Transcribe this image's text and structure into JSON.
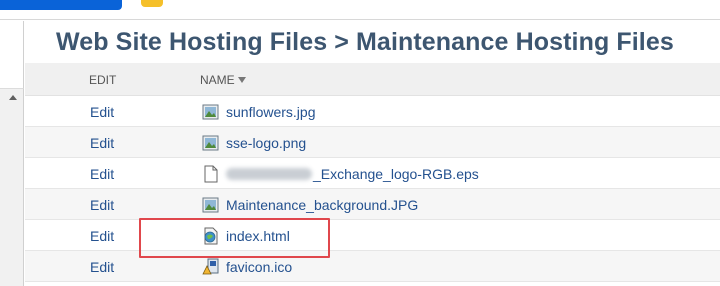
{
  "title": "Web Site Hosting Files > Maintenance Hosting Files",
  "colors": {
    "title": "#3d5670",
    "link": "#24518f",
    "highlight": "#e0474c"
  },
  "table": {
    "columns": {
      "edit": "EDIT",
      "name": "NAME"
    },
    "rows": [
      {
        "edit": "Edit",
        "name": "sunflowers.jpg",
        "icon": "image-file-icon"
      },
      {
        "edit": "Edit",
        "name": "sse-logo.png",
        "icon": "image-file-icon"
      },
      {
        "edit": "Edit",
        "name": "_Exchange_logo-RGB.eps",
        "icon": "blank-file-icon"
      },
      {
        "edit": "Edit",
        "name": "Maintenance_background.JPG",
        "icon": "image-file-icon"
      },
      {
        "edit": "Edit",
        "name": "index.html",
        "icon": "html-file-icon"
      },
      {
        "edit": "Edit",
        "name": "favicon.ico",
        "icon": "ico-file-icon"
      }
    ]
  }
}
